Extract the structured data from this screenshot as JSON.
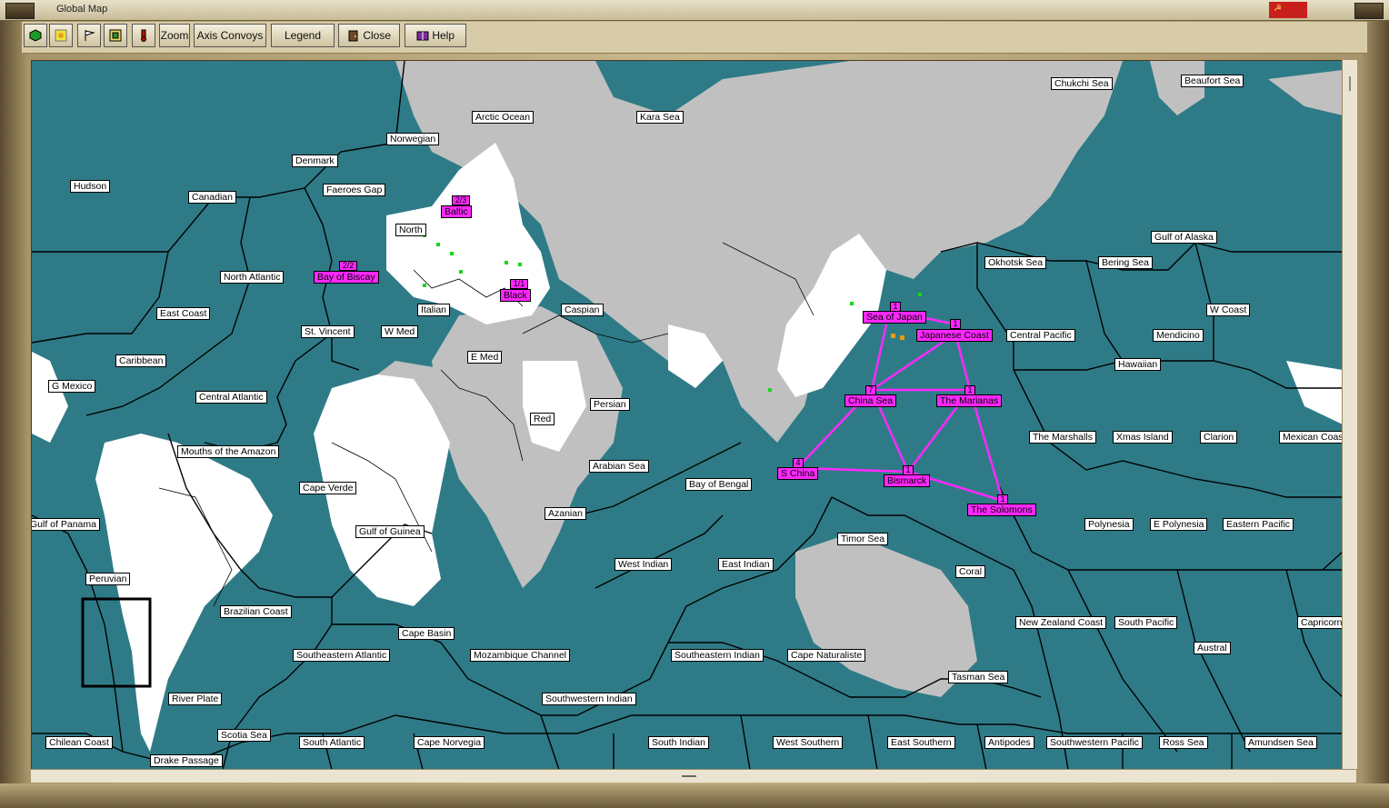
{
  "window": {
    "title": "Global Map"
  },
  "toolbar": {
    "zoom_label": "Zoom",
    "axis_convoys_label": "Axis Convoys",
    "legend_label": "Legend",
    "close_label": "Close",
    "help_label": "Help"
  },
  "colors": {
    "ocean": "#2e7b87",
    "land_neutral": "#c0c0c0",
    "land_allied": "#ffffff",
    "convoy": "#ff28ff",
    "unit_green": "#18d818"
  },
  "sea_zones": [
    "Chukchi Sea",
    "Beaufort Sea",
    "Arctic Ocean",
    "Kara Sea",
    "Norwegian",
    "Denmark",
    "Hudson",
    "Faeroes Gap",
    "Canadian",
    "North",
    "Gulf of Alaska",
    "Okhotsk Sea",
    "Bering Sea",
    "North Atlantic",
    "Italian",
    "Caspian",
    "East Coast",
    "St. Vincent",
    "W Med",
    "Central Pacific",
    "W Coast",
    "Mendicino",
    "Caribbean",
    "E Med",
    "Hawaiian",
    "G Mexico",
    "Central Atlantic",
    "Persian",
    "Red",
    "The Marshalls",
    "Xmas Island",
    "Clarion",
    "Mexican Coast",
    "Mouths of the Amazon",
    "Arabian Sea",
    "Bay of Bengal",
    "Cape Verde",
    "Azanian",
    "Gulf of Panama",
    "Gulf of Guinea",
    "Polynesia",
    "E Polynesia",
    "Eastern Pacific",
    "Timor Sea",
    "Peruvian",
    "West Indian",
    "East Indian",
    "Coral",
    "Brazilian Coast",
    "New Zealand Coast",
    "South Pacific",
    "Cape Basin",
    "Austral",
    "Capricorn",
    "Southeastern Atlantic",
    "Mozambique Channel",
    "Southeastern Indian",
    "Cape Naturaliste",
    "Tasman Sea",
    "River Plate",
    "Southwestern Indian",
    "Scotia Sea",
    "Chilean Coast",
    "South Atlantic",
    "Cape Norvegia",
    "South Indian",
    "West Southern",
    "East Southern",
    "Antipodes",
    "Southwestern Pacific",
    "Ross Sea",
    "Amundsen Sea",
    "Drake Passage"
  ],
  "convoy_zones": [
    {
      "name": "Baltic",
      "count": "2/3"
    },
    {
      "name": "Bay of Biscay",
      "count": "2/2"
    },
    {
      "name": "Black",
      "count": "1/1"
    },
    {
      "name": "Sea of Japan",
      "count": "1"
    },
    {
      "name": "Japanese Coast",
      "count": "1"
    },
    {
      "name": "China Sea",
      "count": "7"
    },
    {
      "name": "The Marianas",
      "count": "1"
    },
    {
      "name": "S China",
      "count": "4"
    },
    {
      "name": "Bismarck",
      "count": "1"
    },
    {
      "name": "The Solomons",
      "count": "1"
    }
  ]
}
